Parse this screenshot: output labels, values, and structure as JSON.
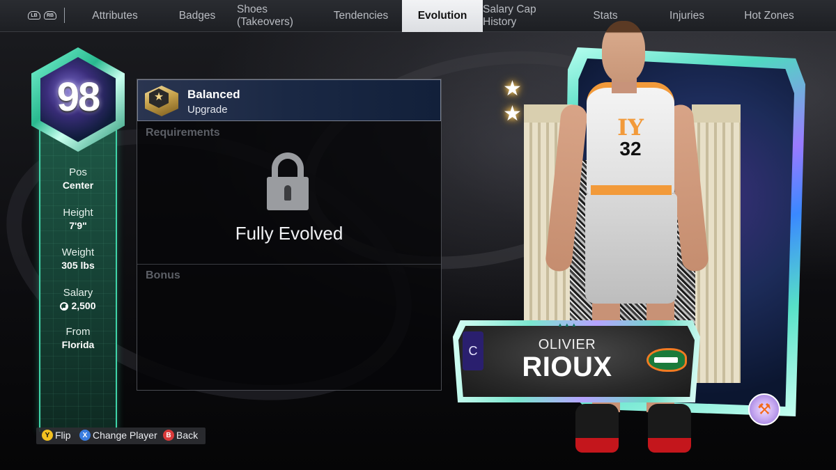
{
  "nav": {
    "bumpers": {
      "left": "LB",
      "right": "RB"
    },
    "tabs": [
      {
        "label": "Attributes",
        "active": false
      },
      {
        "label": "Badges",
        "active": false
      },
      {
        "label": "Shoes (Takeovers)",
        "active": false
      },
      {
        "label": "Tendencies",
        "active": false
      },
      {
        "label": "Evolution",
        "active": true
      },
      {
        "label": "Salary Cap History",
        "active": false
      },
      {
        "label": "Stats",
        "active": false
      },
      {
        "label": "Injuries",
        "active": false
      },
      {
        "label": "Hot Zones",
        "active": false
      }
    ]
  },
  "player": {
    "overall": "98",
    "info": [
      {
        "label": "Pos",
        "value": "Center"
      },
      {
        "label": "Height",
        "value": "7'9\""
      },
      {
        "label": "Weight",
        "value": "305 lbs"
      },
      {
        "label": "Salary",
        "value": "2,500"
      },
      {
        "label": "From",
        "value": "Florida"
      }
    ],
    "first_name": "OLIVIER",
    "last_name": "RIOUX",
    "position_abbr": "C",
    "jersey_letters": "IY",
    "jersey_number": "32",
    "stars": 2
  },
  "evolution": {
    "title": "Balanced",
    "subtitle": "Upgrade",
    "requirements_label": "Requirements",
    "status_text": "Fully Evolved",
    "bonus_label": "Bonus"
  },
  "controls": [
    {
      "button": "Y",
      "label": "Flip"
    },
    {
      "button": "X",
      "label": "Change Player"
    },
    {
      "button": "B",
      "label": "Back"
    }
  ],
  "colors": {
    "accent_teal": "#3fd3a8",
    "active_tab_bg": "#f2f3f5",
    "jersey_orange": "#f29a3a"
  }
}
